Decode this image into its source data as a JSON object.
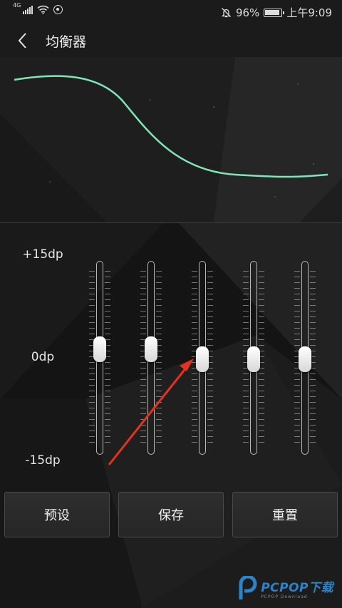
{
  "status_bar": {
    "network_badge": "4G",
    "battery_percent": "96%",
    "time": "上午9:09",
    "icons": [
      "signal-icon",
      "wifi-icon",
      "hotspot-icon",
      "mute-bell-icon",
      "battery-icon"
    ]
  },
  "header": {
    "back_icon": "chevron-left-icon",
    "title": "均衡器"
  },
  "equalizer": {
    "curve_color": "#7fe6b7",
    "labels": {
      "max": "+15dp",
      "mid": "0dp",
      "min": "-15dp"
    },
    "bands": [
      {
        "level_db": 1.5
      },
      {
        "level_db": 1.5
      },
      {
        "level_db": -0.2
      },
      {
        "level_db": -0.2
      },
      {
        "level_db": -0.2
      }
    ],
    "range_db": [
      -15,
      15
    ]
  },
  "buttons": {
    "preset_label": "预设",
    "save_label": "保存",
    "reset_label": "重置"
  },
  "annotation": {
    "arrow_color": "#e5321f"
  },
  "watermark": {
    "brand": "PCPOP下载",
    "tagline": "PCPOP Download"
  }
}
